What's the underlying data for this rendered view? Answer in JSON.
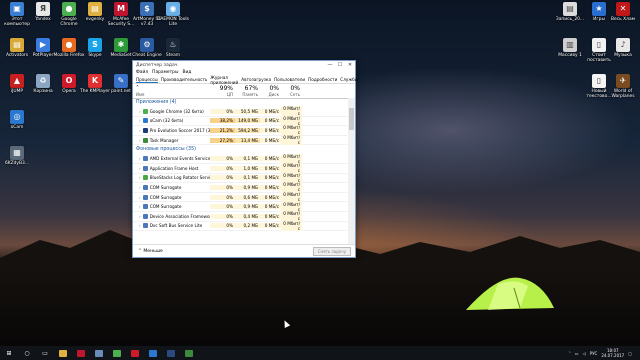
{
  "desktop": {
    "icons_left": [
      {
        "label": "Этот компьютер",
        "icon": "computer-icon",
        "color": "#3a7fd4",
        "glyph": "▣"
      },
      {
        "label": "Yandex",
        "icon": "yandex-icon",
        "color": "#e8e8e8",
        "glyph": "Я"
      },
      {
        "label": "Google Chrome",
        "icon": "chrome-icon",
        "color": "#4caf50",
        "glyph": "●"
      },
      {
        "label": "evgenky",
        "icon": "user-folder-icon",
        "color": "#e0b040",
        "glyph": "▤"
      },
      {
        "label": "McAfee Security S...",
        "icon": "mcafee-icon",
        "color": "#c0152f",
        "glyph": "M"
      },
      {
        "label": "ArtMoney SE v7.43",
        "icon": "artmoney-icon",
        "color": "#3b6fb6",
        "glyph": "$"
      },
      {
        "label": "DAEMON Tools Lite",
        "icon": "daemon-tools-icon",
        "color": "#6ab0e8",
        "glyph": "◉"
      },
      {
        "label": "Activators",
        "icon": "activators-folder-icon",
        "color": "#d8a838",
        "glyph": "▤"
      },
      {
        "label": "PotPlayer",
        "icon": "potplayer-icon",
        "color": "#3b7be0",
        "glyph": "▶"
      },
      {
        "label": "Mozilla Firefox",
        "icon": "firefox-icon",
        "color": "#e66a1f",
        "glyph": "●"
      },
      {
        "label": "Skype",
        "icon": "skype-icon",
        "color": "#1aa3e8",
        "glyph": "S"
      },
      {
        "label": "MediaGet",
        "icon": "mediaget-icon",
        "color": "#2d9a3a",
        "glyph": "✱"
      },
      {
        "label": "Cheat Engine",
        "icon": "cheat-engine-icon",
        "color": "#2a5aa0",
        "glyph": "⚙"
      },
      {
        "label": "Steam",
        "icon": "steam-icon",
        "color": "#1b2838",
        "glyph": "♨"
      },
      {
        "label": "iJUMP",
        "icon": "ijump-icon",
        "color": "#c82020",
        "glyph": "▲"
      },
      {
        "label": "Корзина",
        "icon": "recycle-bin-icon",
        "color": "#8aa6c2",
        "glyph": "♻"
      },
      {
        "label": "Opera",
        "icon": "opera-icon",
        "color": "#d01a2a",
        "glyph": "O"
      },
      {
        "label": "The KMPlayer",
        "icon": "kmplayer-icon",
        "color": "#e03030",
        "glyph": "K"
      },
      {
        "label": "paint.net",
        "icon": "paintnet-icon",
        "color": "#3870c8",
        "glyph": "✎"
      },
      {
        "label": "oCam",
        "icon": "ocam-icon",
        "color": "#2a78d0",
        "glyph": "◎"
      },
      {
        "label": "6KZdyB3...",
        "icon": "image-file-icon",
        "color": "#5a6a7a",
        "glyph": "▦"
      }
    ],
    "icons_right": [
      {
        "label": "Запись_20...",
        "icon": "recording-file-icon",
        "color": "#dcdcdc",
        "glyph": "▤"
      },
      {
        "label": "Игры",
        "icon": "games-star-icon",
        "color": "#2a6fd0",
        "glyph": "★"
      },
      {
        "label": "Весь Хлам",
        "icon": "trash-x-icon",
        "color": "#c01818",
        "glyph": "✕"
      },
      {
        "label": "Музыка",
        "icon": "music-icon",
        "color": "#e8e8e8",
        "glyph": "♪"
      },
      {
        "label": "Массиву 1",
        "icon": "archive-icon",
        "color": "#cfcfcf",
        "glyph": "▥"
      },
      {
        "label": "Стоит поставить",
        "icon": "document-icon",
        "color": "#f2f2f2",
        "glyph": "▯"
      },
      {
        "label": "Новый текстово...",
        "icon": "text-file-icon",
        "color": "#f4f4f4",
        "glyph": "▯"
      },
      {
        "label": "World of Warplanes",
        "icon": "warplanes-icon",
        "color": "#7a4a20",
        "glyph": "✈"
      }
    ]
  },
  "task_manager": {
    "title": "Диспетчер задач",
    "menu": [
      "Файл",
      "Параметры",
      "Вид"
    ],
    "tabs": [
      "Процессы",
      "Производительность",
      "Журнал приложений",
      "Автозагрузка",
      "Пользователи",
      "Подробности",
      "Службы"
    ],
    "headers": {
      "name": "Имя",
      "cpu_pct": "99%",
      "cpu_label": "ЦП",
      "mem_pct": "67%",
      "mem_label": "Память",
      "disk_pct": "0%",
      "disk_label": "Диск",
      "net_pct": "0%",
      "net_label": "Сеть"
    },
    "apps_section": "Приложения (4)",
    "apps": [
      {
        "name": "Google Chrome (32 бита)",
        "cpu": "0%",
        "mem": "50,5 МБ",
        "disk": "0 МБ/с",
        "net": "0 Мбит/с",
        "color": "#4caf50",
        "hot": false
      },
      {
        "name": "oCam (32 бита)",
        "cpu": "38,2%",
        "mem": "149,0 МБ",
        "disk": "0 МБ/с",
        "net": "0 Мбит/с",
        "color": "#2a78d0",
        "hot": true
      },
      {
        "name": "Pro Evolution Soccer 2017 (32 б...",
        "cpu": "21,2%",
        "mem": "594,2 МБ",
        "disk": "0 МБ/с",
        "net": "0 Мбит/с",
        "color": "#1a3a7a",
        "hot": true
      },
      {
        "name": "Task Manager",
        "cpu": "27,2%",
        "mem": "13,4 МБ",
        "disk": "0 МБ/с",
        "net": "0 Мбит/с",
        "color": "#3c8a3c",
        "hot": true
      }
    ],
    "bg_section": "Фоновые процессы (35)",
    "background": [
      {
        "name": "AMD External Events Service M...",
        "cpu": "0%",
        "mem": "0,1 МБ",
        "disk": "0 МБ/с",
        "net": "0 Мбит/с",
        "color": "#4a78b8"
      },
      {
        "name": "Application Frame Host",
        "cpu": "0%",
        "mem": "1,0 МБ",
        "disk": "0 МБ/с",
        "net": "0 Мбит/с",
        "color": "#4a78b8"
      },
      {
        "name": "BlueStacks Log Rotator Service (...",
        "cpu": "0%",
        "mem": "0,1 МБ",
        "disk": "0 МБ/с",
        "net": "0 Мбит/с",
        "color": "#4aa840"
      },
      {
        "name": "COM Surrogate",
        "cpu": "0%",
        "mem": "0,9 МБ",
        "disk": "0 МБ/с",
        "net": "0 Мбит/с",
        "color": "#4a78b8"
      },
      {
        "name": "COM Surrogate",
        "cpu": "0%",
        "mem": "0,6 МБ",
        "disk": "0 МБ/с",
        "net": "0 Мбит/с",
        "color": "#4a78b8"
      },
      {
        "name": "COM Surrogate",
        "cpu": "0%",
        "mem": "0,9 МБ",
        "disk": "0 МБ/с",
        "net": "0 Мбит/с",
        "color": "#4a78b8"
      },
      {
        "name": "Device Association Framework ...",
        "cpu": "0%",
        "mem": "0,4 МБ",
        "disk": "0 МБ/с",
        "net": "0 Мбит/с",
        "color": "#4a78b8"
      },
      {
        "name": "Dvc Soft Bus Service Lite",
        "cpu": "0%",
        "mem": "0,2 МБ",
        "disk": "0 МБ/с",
        "net": "0 Мбит/с",
        "color": "#4a78b8"
      }
    ],
    "less_label": "Меньше",
    "end_task_label": "Снять задачу"
  },
  "taskbar": {
    "items": [
      {
        "icon": "start-icon",
        "color": "#ffffff"
      },
      {
        "icon": "search-icon",
        "color": "#ffffff"
      },
      {
        "icon": "task-view-icon",
        "color": "#ffffff"
      },
      {
        "icon": "file-explorer-icon",
        "color": "#e0b040"
      },
      {
        "icon": "mcafee-taskbar-icon",
        "color": "#c0152f"
      },
      {
        "icon": "steam-taskbar-icon",
        "color": "#6a8cb8"
      },
      {
        "icon": "chrome-taskbar-icon",
        "color": "#4caf50"
      },
      {
        "icon": "opera-taskbar-icon",
        "color": "#d01a2a"
      },
      {
        "icon": "ocam-taskbar-icon",
        "color": "#2a78d0"
      },
      {
        "icon": "game-taskbar-icon",
        "color": "#2a4a80"
      },
      {
        "icon": "task-manager-taskbar-icon",
        "color": "#3c8a3c"
      }
    ],
    "language": "РУС",
    "time": "18:07",
    "date": "24.07.2017"
  }
}
